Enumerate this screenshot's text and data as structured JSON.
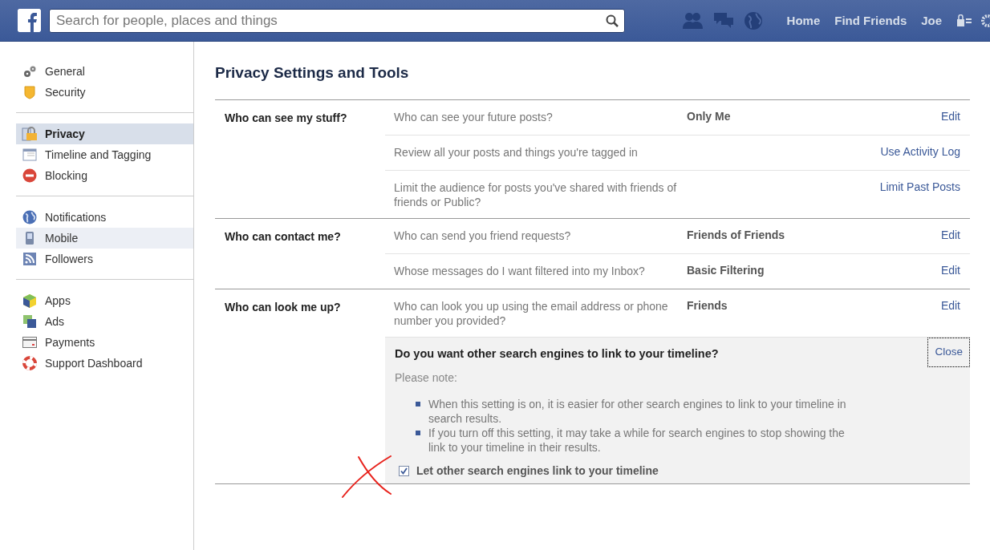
{
  "top_bar": {
    "search": {
      "placeholder": "Search for people, places and things"
    },
    "nav_links": [
      "Home",
      "Find Friends",
      "Joe"
    ]
  },
  "sidebar": {
    "groups": [
      [
        {
          "label": "General",
          "selected": false,
          "hovered": false
        },
        {
          "label": "Security",
          "selected": false,
          "hovered": false
        }
      ],
      [
        {
          "label": "Privacy",
          "selected": true,
          "hovered": false
        },
        {
          "label": "Timeline and Tagging",
          "selected": false,
          "hovered": false
        },
        {
          "label": "Blocking",
          "selected": false,
          "hovered": false
        }
      ],
      [
        {
          "label": "Notifications",
          "selected": false,
          "hovered": false
        },
        {
          "label": "Mobile",
          "selected": false,
          "hovered": true
        },
        {
          "label": "Followers",
          "selected": false,
          "hovered": false
        }
      ],
      [
        {
          "label": "Apps",
          "selected": false,
          "hovered": false
        },
        {
          "label": "Ads",
          "selected": false,
          "hovered": false
        },
        {
          "label": "Payments",
          "selected": false,
          "hovered": false
        },
        {
          "label": "Support Dashboard",
          "selected": false,
          "hovered": false
        }
      ]
    ]
  },
  "page_title": "Privacy Settings and Tools",
  "sections": [
    {
      "title": "Who can see my stuff?",
      "rows": [
        {
          "question": "Who can see your future posts?",
          "value": "Only Me",
          "action": "Edit"
        },
        {
          "question": "Review all your posts and things you're tagged in",
          "action": "Use Activity Log"
        },
        {
          "question": "Limit the audience for posts you've shared with friends of friends or Public?",
          "action": "Limit Past Posts"
        }
      ]
    },
    {
      "title": "Who can contact me?",
      "rows": [
        {
          "question": "Who can send you friend requests?",
          "value": "Friends of Friends",
          "action": "Edit"
        },
        {
          "question": "Whose messages do I want filtered into my Inbox?",
          "value": "Basic Filtering",
          "action": "Edit"
        }
      ]
    },
    {
      "title": "Who can look me up?",
      "rows": [
        {
          "question": "Who can look you up using the email address or phone number you provided?",
          "value": "Friends",
          "action": "Edit"
        }
      ],
      "panel": {
        "heading": "Do you want other search engines to link to your timeline?",
        "close": "Close",
        "note": "Please note:",
        "bullets": [
          "When this setting is on, it is easier for other search engines to link to your timeline in search results.",
          "If you turn off this setting, it may take a while for search engines to stop showing the link to your timeline in their results."
        ],
        "checkbox": {
          "label": "Let other search engines link to your timeline",
          "checked": true
        }
      }
    }
  ]
}
